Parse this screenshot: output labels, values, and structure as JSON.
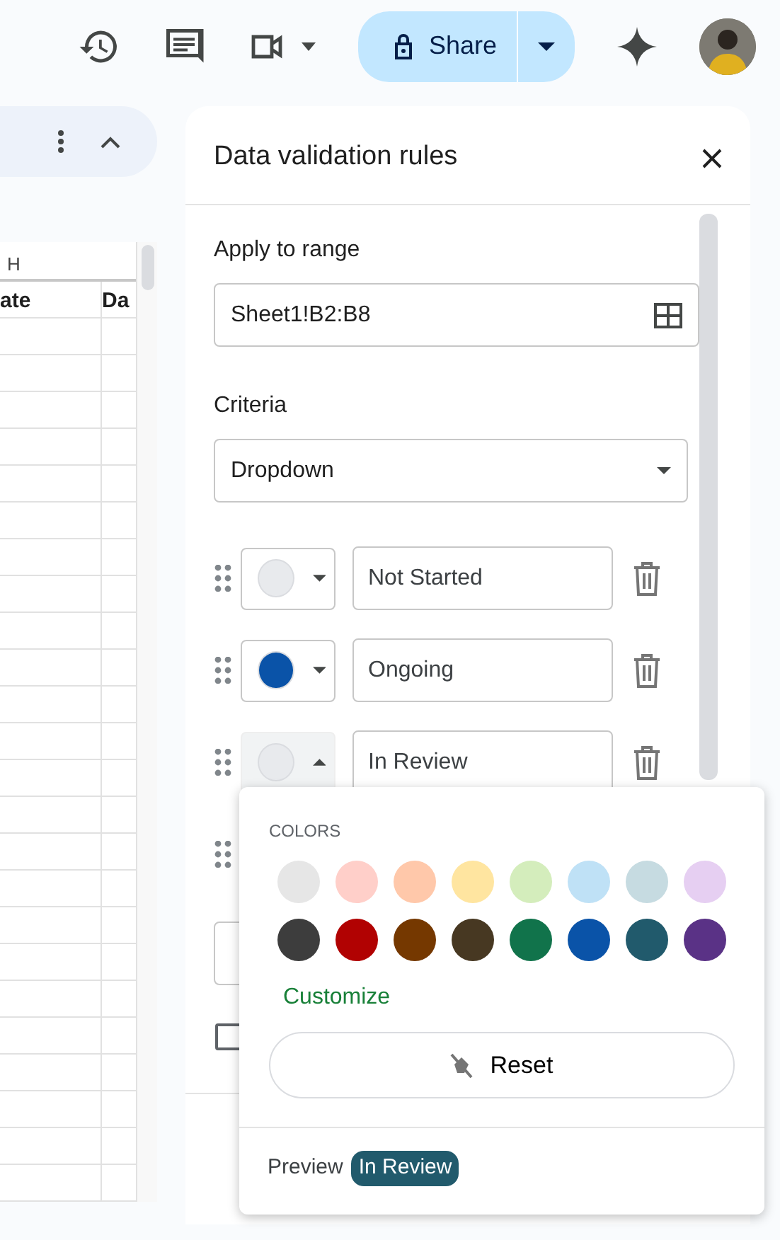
{
  "top_bar": {
    "share_label": "Share"
  },
  "sheet": {
    "column_header": "H",
    "header_cells": [
      "ate",
      "Da"
    ]
  },
  "panel": {
    "title": "Data validation rules",
    "range_label": "Apply to range",
    "range_value": "Sheet1!B2:B8",
    "criteria_label": "Criteria",
    "criteria_value": "Dropdown",
    "options": [
      {
        "text": "Not Started",
        "color": "#e8eaed",
        "expanded": false
      },
      {
        "text": "Ongoing",
        "color": "#0a53a8",
        "expanded": false
      },
      {
        "text": "In Review",
        "color": "#e8eaed",
        "expanded": true
      }
    ],
    "advanced_checkbox": {
      "checked": false
    }
  },
  "color_menu": {
    "heading": "COLORS",
    "palette": [
      {
        "color": "#e6e6e6"
      },
      {
        "color": "#ffcfc9"
      },
      {
        "color": "#ffc8aa"
      },
      {
        "color": "#ffe5a0"
      },
      {
        "color": "#d4edbc"
      },
      {
        "color": "#bfe1f6"
      },
      {
        "color": "#c6dbe1"
      },
      {
        "color": "#e6cff2"
      },
      {
        "color": "#3d3d3d"
      },
      {
        "color": "#b10202"
      },
      {
        "color": "#753800"
      },
      {
        "color": "#473822"
      },
      {
        "color": "#11734b"
      },
      {
        "color": "#0a53a8"
      },
      {
        "color": "#215a6c"
      },
      {
        "color": "#5a3286"
      }
    ],
    "customize_label": "Customize",
    "reset_label": "Reset",
    "preview_label": "Preview",
    "preview_chip": {
      "text": "In Review",
      "color": "#215a6c"
    }
  }
}
